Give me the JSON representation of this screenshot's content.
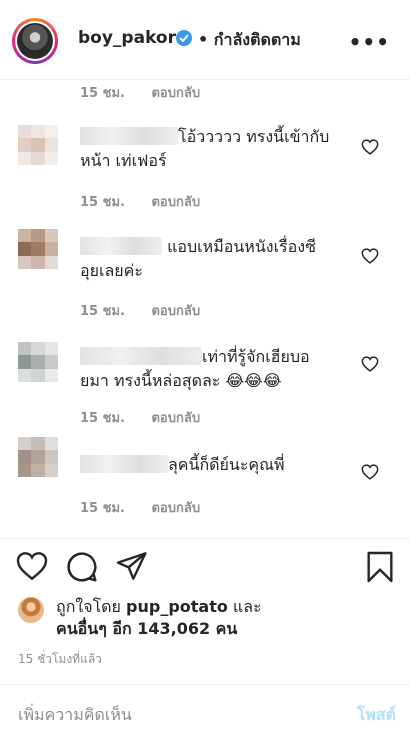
{
  "header": {
    "username": "boy_pakorn",
    "follow_status": "• กำลังติดตาม",
    "more_label": "•••"
  },
  "partial_comment": {
    "time": "15 ชม.",
    "reply": "ตอบกลับ"
  },
  "comments": [
    {
      "text_line1": "โอ้ววววว ทรงนี้เข้ากับ",
      "text_line2": "หน้า เท่เฟอร์",
      "time": "15 ชม.",
      "reply": "ตอบกลับ",
      "avatar_colors": [
        "#e8ddd6",
        "#efe5de",
        "#f4efea",
        "#e2cfc4",
        "#d9c2b6",
        "#ece2dc",
        "#f0e8e2",
        "#e6d8cf",
        "#f3eeea"
      ]
    },
    {
      "text_line1": "แอบเหมือนหนังเรื่องซี",
      "text_line2": "อุยเลยค่ะ",
      "time": "15 ชม.",
      "reply": "ตอบกลับ",
      "avatar_colors": [
        "#c9b3a3",
        "#b59a86",
        "#d7c8bc",
        "#8f6a52",
        "#a07b63",
        "#c7b0a0",
        "#d9c6c2",
        "#cfb7b0",
        "#e5d9d5"
      ]
    },
    {
      "text_line1": "เท่าที่รู้จักเฮียบอ",
      "text_line2": "ยมา ทรงนี้หล่อสุดละ 😂😂😂",
      "time": "15 ชม.",
      "reply": "ตอบกลับ",
      "avatar_colors": [
        "#bfc3c2",
        "#d5d8d7",
        "#e3e5e4",
        "#8d9795",
        "#a9b1af",
        "#c6cbca",
        "#dcdedd",
        "#cfd3d2",
        "#e8eae9"
      ]
    },
    {
      "text_line1": "ลุคนี้ก็ดีย์นะคุณพี่",
      "text_line2": "",
      "time": "15 ชม.",
      "reply": "ตอบกลับ",
      "avatar_colors": [
        "#d6d0cc",
        "#c5bdb7",
        "#e2ddda",
        "#9f9189",
        "#b2a49b",
        "#cfc5bf",
        "#a8958a",
        "#bfb0a6",
        "#d8cec8"
      ]
    }
  ],
  "actions": {
    "like_icon": "heart-icon",
    "comment_icon": "speech-bubble-icon",
    "share_icon": "paper-plane-icon",
    "save_icon": "bookmark-icon"
  },
  "likes": {
    "prefix": "ถูกใจโดย ",
    "user": "pup_potato",
    "suffix": " และ",
    "others": "คนอื่นๆ อีก 143,062 คน"
  },
  "post_time": "15 ชั่วโมงที่แล้ว",
  "add_comment": {
    "placeholder": "เพิ่มความคิดเห็น",
    "post_label": "โพสต์"
  },
  "colors": {
    "text": "#262626",
    "muted": "#8e8e8e",
    "verified": "#3897f0",
    "post_disabled": "#b2dffc"
  }
}
